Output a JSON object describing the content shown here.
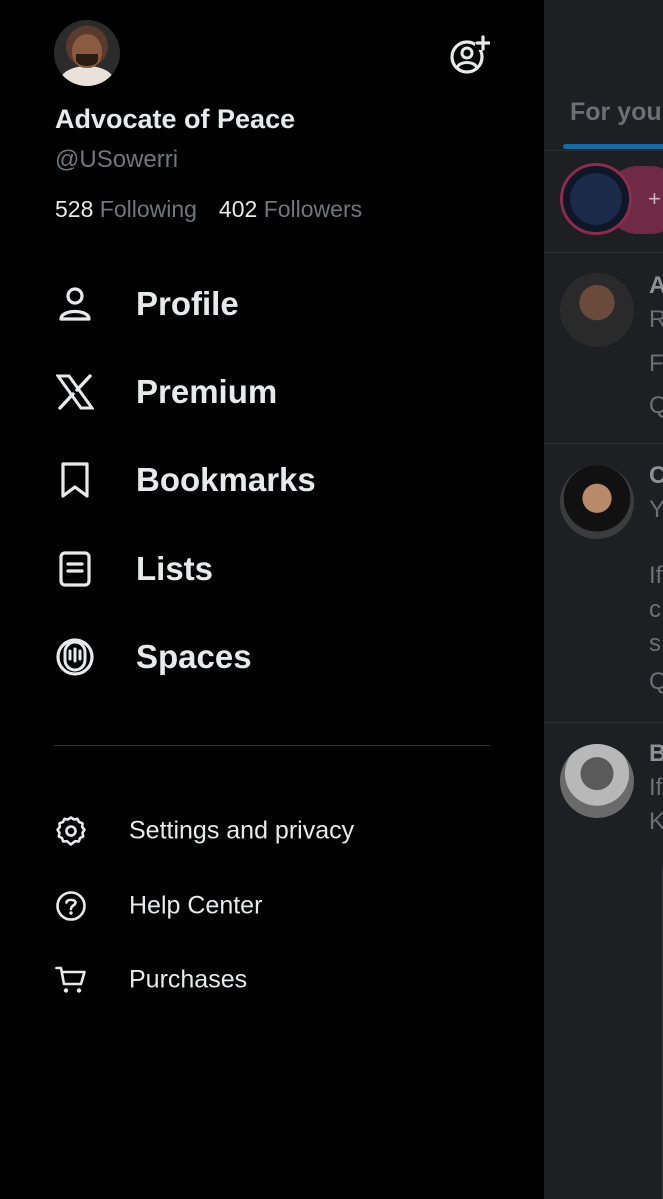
{
  "profile": {
    "display_name": "Advocate of Peace",
    "handle": "@USowerri",
    "following_count": "528",
    "following_label": "Following",
    "followers_count": "402",
    "followers_label": "Followers"
  },
  "main_nav": [
    {
      "label": "Profile",
      "icon": "person-icon"
    },
    {
      "label": "Premium",
      "icon": "x-logo-icon"
    },
    {
      "label": "Bookmarks",
      "icon": "bookmark-icon"
    },
    {
      "label": "Lists",
      "icon": "list-icon"
    },
    {
      "label": "Spaces",
      "icon": "spaces-mic-icon"
    }
  ],
  "secondary_nav": [
    {
      "label": "Settings and privacy",
      "icon": "gear-icon"
    },
    {
      "label": "Help Center",
      "icon": "help-icon"
    },
    {
      "label": "Purchases",
      "icon": "cart-icon"
    }
  ],
  "timeline": {
    "tab_label": "For you",
    "story_plus": "+",
    "posts": [
      {
        "letters": [
          "A",
          "R",
          "F",
          "Q"
        ]
      },
      {
        "letters": [
          "C",
          "Y",
          "If",
          "c",
          "s",
          "Q"
        ]
      },
      {
        "letters": [
          "B",
          "If",
          "K"
        ]
      }
    ]
  },
  "colors": {
    "background": "#000000",
    "text_primary": "#e7e9ea",
    "text_secondary": "#71767b",
    "divider": "#2f3336",
    "accent": "#1d9bf0"
  }
}
